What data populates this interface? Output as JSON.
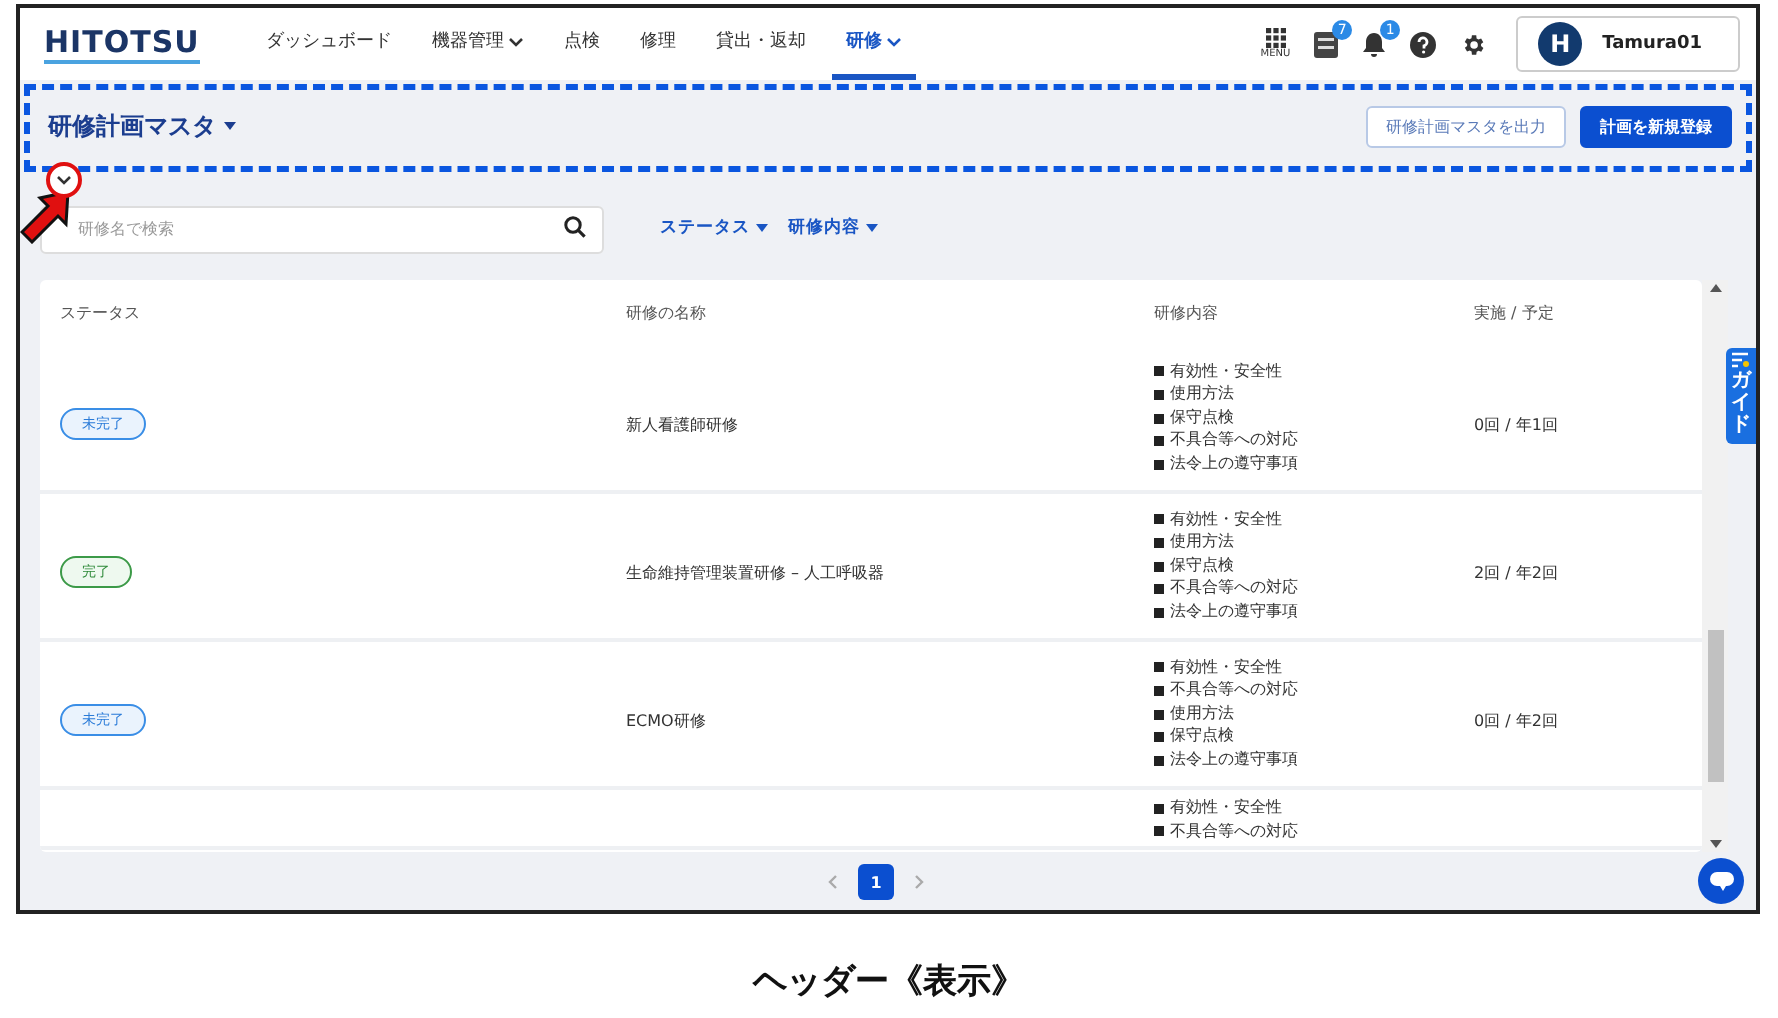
{
  "header": {
    "logo": "HITOTSU",
    "nav": [
      {
        "label": "ダッシュボード",
        "dropdown": false,
        "selected": false
      },
      {
        "label": "機器管理",
        "dropdown": true,
        "selected": false
      },
      {
        "label": "点検",
        "dropdown": false,
        "selected": false
      },
      {
        "label": "修理",
        "dropdown": false,
        "selected": false
      },
      {
        "label": "貸出・返却",
        "dropdown": false,
        "selected": false
      },
      {
        "label": "研修",
        "dropdown": true,
        "selected": true
      }
    ],
    "menu_label": "MENU",
    "pmda_badge": "7",
    "notification_badge": "1",
    "user": {
      "avatar_letter": "H",
      "name": "Tamura01"
    }
  },
  "page_header": {
    "title": "研修計画マスタ",
    "buttons": [
      {
        "label": "研修計画マスタを出力",
        "kind": "outline"
      },
      {
        "label": "計画を新規登録",
        "kind": "primary"
      }
    ]
  },
  "search": {
    "placeholder": "研修名で検索"
  },
  "filters": [
    "ステータス",
    "研修内容"
  ],
  "table": {
    "columns": [
      "ステータス",
      "研修の名称",
      "研修内容",
      "実施 / 予定"
    ],
    "rows": [
      {
        "status": {
          "label": "未完了",
          "kind": "incomplete"
        },
        "name": "新人看護師研修",
        "contents": [
          "有効性・安全性",
          "使用方法",
          "保守点検",
          "不具合等への対応",
          "法令上の遵守事項"
        ],
        "count": "0回 / 年1回"
      },
      {
        "status": {
          "label": "完了",
          "kind": "complete"
        },
        "name": "生命維持管理装置研修 – 人工呼吸器",
        "contents": [
          "有効性・安全性",
          "使用方法",
          "保守点検",
          "不具合等への対応",
          "法令上の遵守事項"
        ],
        "count": "2回 / 年2回"
      },
      {
        "status": {
          "label": "未完了",
          "kind": "incomplete"
        },
        "name": "ECMO研修",
        "contents": [
          "有効性・安全性",
          "不具合等への対応",
          "使用方法",
          "保守点検",
          "法令上の遵守事項"
        ],
        "count": "0回 / 年2回"
      },
      {
        "contents": [
          "有効性・安全性",
          "不具合等への対応"
        ]
      }
    ]
  },
  "pagination": [
    {
      "label": "1",
      "selected": true
    }
  ],
  "guide_tab": "ガイド",
  "caption": "ヘッダー《表示》"
}
